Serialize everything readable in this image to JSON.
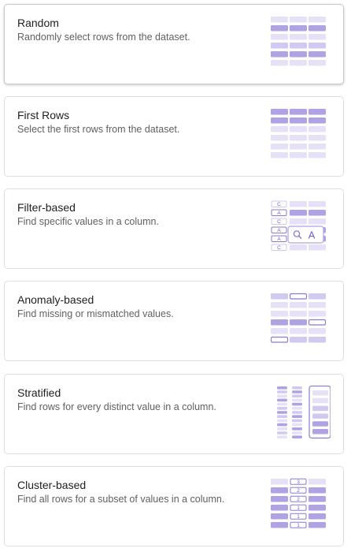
{
  "colors": {
    "light": "#e6e1f7",
    "mid": "#d2c9f0",
    "dark": "#b0a2e3",
    "accent": "#8b7bd3",
    "accent_text": "#6e5fc7",
    "title": "#1f1f1f",
    "desc": "#616161"
  },
  "sampling_options": [
    {
      "id": "random",
      "title": "Random",
      "description": "Randomly select rows from the dataset.",
      "icon": "random-rows-icon",
      "selected": true
    },
    {
      "id": "first-rows",
      "title": "First Rows",
      "description": "Select the first rows from the dataset.",
      "icon": "first-rows-icon",
      "selected": false
    },
    {
      "id": "filter-based",
      "title": "Filter-based",
      "description": "Find specific values in a column.",
      "icon": "filter-rows-icon",
      "selected": false,
      "illustration": {
        "column_values": [
          "C",
          "A",
          "C",
          "A",
          "A",
          "C"
        ],
        "search_value": "A"
      }
    },
    {
      "id": "anomaly-based",
      "title": "Anomaly-based",
      "description": "Find missing or mismatched values.",
      "icon": "anomaly-rows-icon",
      "selected": false
    },
    {
      "id": "stratified",
      "title": "Stratified",
      "description": "Find rows for every distinct value in a column.",
      "icon": "stratified-rows-icon",
      "selected": false
    },
    {
      "id": "cluster-based",
      "title": "Cluster-based",
      "description": "Find all rows for a subset of values in a column.",
      "icon": "cluster-rows-icon",
      "selected": false,
      "illustration": {
        "column_values": [
          "3",
          "2",
          "2",
          "1",
          "1",
          "1"
        ]
      }
    }
  ]
}
